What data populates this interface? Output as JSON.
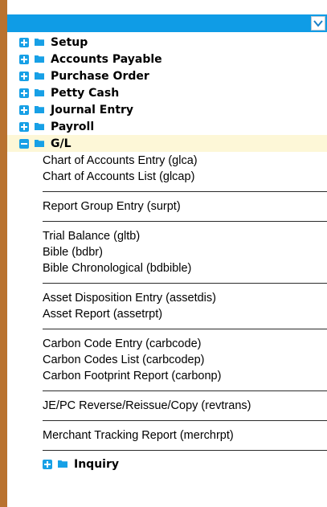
{
  "menu_tree": {
    "top_nodes": [
      {
        "label": "Setup",
        "toggle": "plus"
      },
      {
        "label": "Accounts Payable",
        "toggle": "plus"
      },
      {
        "label": "Purchase Order",
        "toggle": "plus"
      },
      {
        "label": "Petty Cash",
        "toggle": "plus"
      },
      {
        "label": "Journal Entry",
        "toggle": "plus"
      },
      {
        "label": "Payroll",
        "toggle": "plus"
      },
      {
        "label": "G/L",
        "toggle": "minus"
      }
    ],
    "gl_groups": [
      [
        "Chart of Accounts Entry (glca)",
        "Chart of Accounts List (glcap)"
      ],
      [
        "Report Group Entry (surpt)"
      ],
      [
        "Trial Balance (gltb)",
        "Bible (bdbr)",
        "Bible Chronological (bdbible)"
      ],
      [
        "Asset Disposition Entry (assetdis)",
        "Asset Report (assetrpt)"
      ],
      [
        "Carbon Code Entry (carbcode)",
        "Carbon Codes List (carbcodep)",
        "Carbon Footprint Report (carbonp)"
      ],
      [
        "JE/PC Reverse/Reissue/Copy (revtrans)"
      ],
      [
        "Merchant Tracking Report (merchrpt)"
      ]
    ],
    "inquiry": {
      "label": "Inquiry",
      "toggle": "plus"
    }
  },
  "colors": {
    "header_blue": "#0f9ce6",
    "frame_brown": "#b9722f",
    "selected_row": "#fdf7d7",
    "icon_blue": "#17a0e6"
  }
}
